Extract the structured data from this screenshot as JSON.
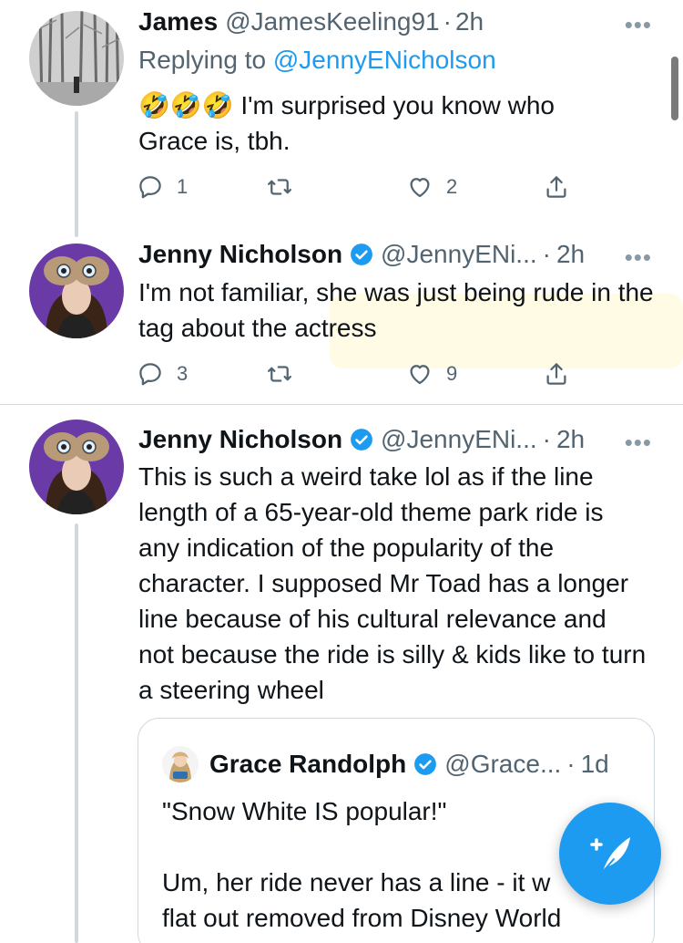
{
  "tweets": [
    {
      "name": "James",
      "handle": "@JamesKeeling91",
      "dot": "·",
      "time": "2h",
      "replying_prefix": "Replying to ",
      "replying_to": "@JennyENicholson",
      "emoji": "🤣🤣🤣",
      "text_line1": " I'm surprised you know who",
      "text_line2": "Grace is, tbh.",
      "replies": "1",
      "retweets": "",
      "likes": "2",
      "more": "•••"
    },
    {
      "name": "Jenny Nicholson",
      "handle": "@JennyENi...",
      "dot": "·",
      "time": "2h",
      "text": "I'm not familiar, she was just being rude in the tag about the actress",
      "replies": "3",
      "retweets": "",
      "likes": "9",
      "more": "•••"
    },
    {
      "name": "Jenny Nicholson",
      "handle": "@JennyENi...",
      "dot": "·",
      "time": "2h",
      "text": "This is such a weird take lol as if the line length of a 65-year-old theme park ride is any indication of the popularity of the character. I supposed Mr Toad has a longer line because of his cultural relevance and not because the ride is silly & kids like to turn a steering wheel",
      "more": "•••"
    }
  ],
  "quote": {
    "name": "Grace Randolph",
    "handle": "@Grace...",
    "dot": "·",
    "time": "1d",
    "line1": "\"Snow White IS popular!\"",
    "line2": "Um, her ride never has a line - it w",
    "line3": "flat out removed from Disney World"
  },
  "colors": {
    "accent": "#1d9bf0",
    "secondary_text": "#536471",
    "primary_text": "#0f1419"
  }
}
